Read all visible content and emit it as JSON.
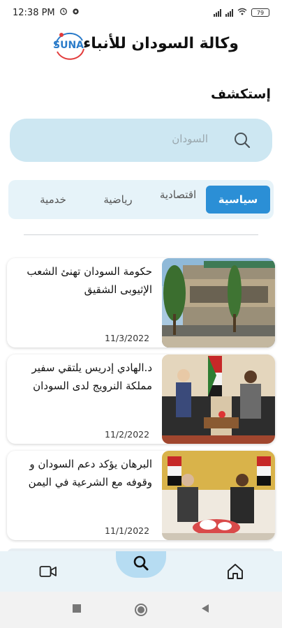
{
  "status_bar": {
    "time": "12:38 PM",
    "battery": "79"
  },
  "header": {
    "app_title": "وكالة السودان للأنباء",
    "logo_text": "SUNA"
  },
  "explore": {
    "title": "إستكشف"
  },
  "search": {
    "placeholder": "السودان"
  },
  "tabs": [
    {
      "label": "سياسية",
      "active": true
    },
    {
      "label": "اقتصادية",
      "active": false
    },
    {
      "label": "رياضية",
      "active": false
    },
    {
      "label": "خدمية",
      "active": false
    }
  ],
  "news": [
    {
      "headline": "حكومة السودان تهنئ الشعب الإثيوبى الشقيق",
      "date": "11/3/2022",
      "image": "government-building-photo"
    },
    {
      "headline": "د.الهادي إدريس يلتقي سفير مملكة النرويج لدى السودان",
      "date": "11/2/2022",
      "image": "meeting-photo"
    },
    {
      "headline": "البرهان يؤكد دعم السودان و وقوفه مع الشرعية في اليمن",
      "date": "11/1/2022",
      "image": "official-meeting-photo"
    }
  ],
  "bottom_nav": {
    "items": [
      "video-icon",
      "search-icon",
      "home-icon"
    ]
  },
  "colors": {
    "accent": "#2b8fd6",
    "search_bg": "#cde7f2",
    "tabs_bg": "#e6f3f9",
    "nav_bg": "#e9f3f8"
  }
}
